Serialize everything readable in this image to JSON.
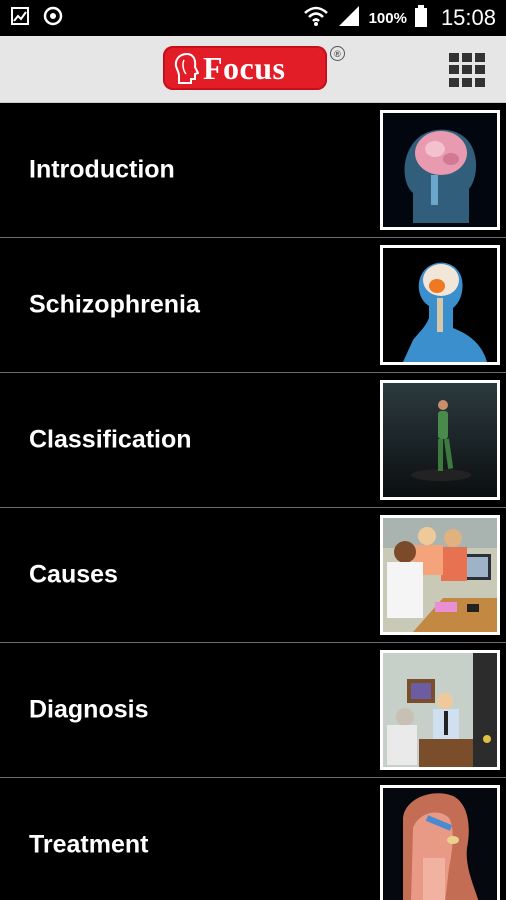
{
  "status_bar": {
    "battery_percent": "100%",
    "time": "15:08",
    "icons": [
      "image-icon",
      "sync-icon",
      "wifi-icon",
      "signal-icon",
      "battery-icon"
    ]
  },
  "app_bar": {
    "logo_text": "Focus",
    "registered_mark": "®",
    "menu_icon": "grid-menu-icon",
    "logo_color": "#e31d28"
  },
  "topics": [
    {
      "label": "Introduction",
      "thumbnail": "brain-head-illustration"
    },
    {
      "label": "Schizophrenia",
      "thumbnail": "head-brain-profile-illustration"
    },
    {
      "label": "Classification",
      "thumbnail": "walking-man-illustration"
    },
    {
      "label": "Causes",
      "thumbnail": "doctor-consultation-illustration"
    },
    {
      "label": "Diagnosis",
      "thumbnail": "doctor-office-illustration"
    },
    {
      "label": "Treatment",
      "thumbnail": "throat-anatomy-illustration"
    }
  ]
}
